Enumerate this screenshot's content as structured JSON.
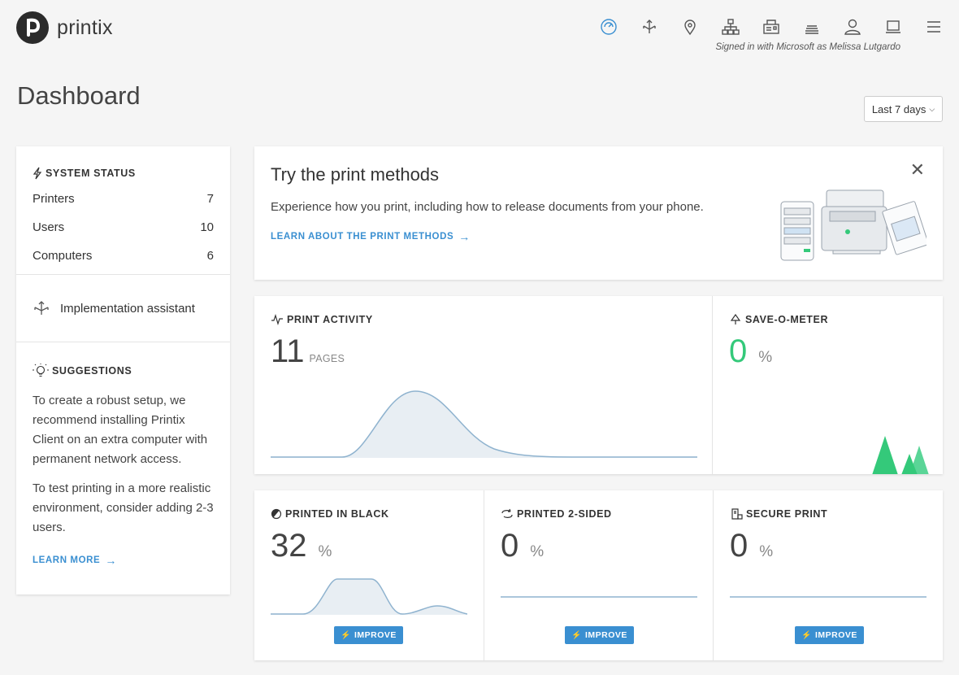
{
  "header": {
    "brand": "printix",
    "signed_in": "Signed in with Microsoft as Melissa Lutgardo",
    "nav_icons": [
      "dashboard-icon",
      "deploy-icon",
      "location-icon",
      "network-icon",
      "printer-icon",
      "queue-icon",
      "user-icon",
      "computer-icon",
      "menu-icon"
    ],
    "active_color": "#3a8fd1"
  },
  "page": {
    "title": "Dashboard",
    "range": "Last 7 days"
  },
  "system_status": {
    "title": "SYSTEM STATUS",
    "rows": [
      {
        "label": "Printers",
        "value": "7"
      },
      {
        "label": "Users",
        "value": "10"
      },
      {
        "label": "Computers",
        "value": "6"
      }
    ]
  },
  "implementation": {
    "label": "Implementation assistant"
  },
  "suggestions": {
    "title": "SUGGESTIONS",
    "p1": "To create a robust setup, we recommend installing Printix Client on an extra computer with permanent network access.",
    "p2": "To test printing in a more realistic environment, consider adding 2-3 users.",
    "link": "LEARN MORE"
  },
  "promo": {
    "title": "Try the print methods",
    "text": "Experience how you print, including how to release documents from your phone.",
    "link": "LEARN ABOUT THE PRINT METHODS"
  },
  "print_activity": {
    "title": "PRINT ACTIVITY",
    "value": "11",
    "unit": "PAGES"
  },
  "save_o_meter": {
    "title": "SAVE-O-METER",
    "value": "0",
    "unit": "%",
    "value_color": "#34c97a"
  },
  "printed_black": {
    "title": "PRINTED IN BLACK",
    "value": "32",
    "unit": "%",
    "button": "IMPROVE"
  },
  "printed_2sided": {
    "title": "PRINTED 2-SIDED",
    "value": "0",
    "unit": "%",
    "button": "IMPROVE"
  },
  "secure_print": {
    "title": "SECURE PRINT",
    "value": "0",
    "unit": "%",
    "button": "IMPROVE"
  }
}
